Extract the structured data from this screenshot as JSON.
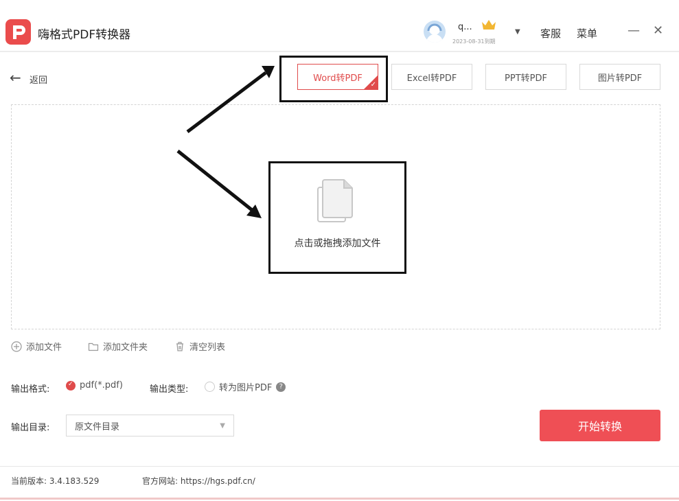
{
  "app": {
    "title": "嗨格式PDF转换器",
    "user_name": "q...",
    "expiry": "2023-08-31到期",
    "service_label": "客服",
    "menu_label": "菜单",
    "minimize_symbol": "—",
    "close_symbol": "✕"
  },
  "nav": {
    "back_label": "返回"
  },
  "tabs": [
    {
      "label": "Word转PDF",
      "active": true
    },
    {
      "label": "Excel转PDF",
      "active": false
    },
    {
      "label": "PPT转PDF",
      "active": false
    },
    {
      "label": "图片转PDF",
      "active": false
    }
  ],
  "drop_area": {
    "prompt": "点击或拖拽添加文件"
  },
  "actions": {
    "add_file": "添加文件",
    "add_folder": "添加文件夹",
    "clear_list": "清空列表"
  },
  "output": {
    "format_label": "输出格式:",
    "format_value": "pdf(*.pdf)",
    "type_label": "输出类型:",
    "type_option": "转为图片PDF",
    "dir_label": "输出目录:",
    "dir_value": "原文件目录"
  },
  "start_button": "开始转换",
  "footer": {
    "version_label": "当前版本: 3.4.183.529",
    "website_label": "官方网站: https://hgs.pdf.cn/"
  },
  "colors": {
    "accent": "#ef4f55",
    "brand_red": "#ea4c4c"
  },
  "icons": [
    "app-logo-icon",
    "avatar-icon",
    "crown-icon",
    "chevron-down-icon",
    "back-arrow-icon",
    "document-stack-icon",
    "plus-circle-icon",
    "folder-icon",
    "trash-icon",
    "help-icon"
  ]
}
